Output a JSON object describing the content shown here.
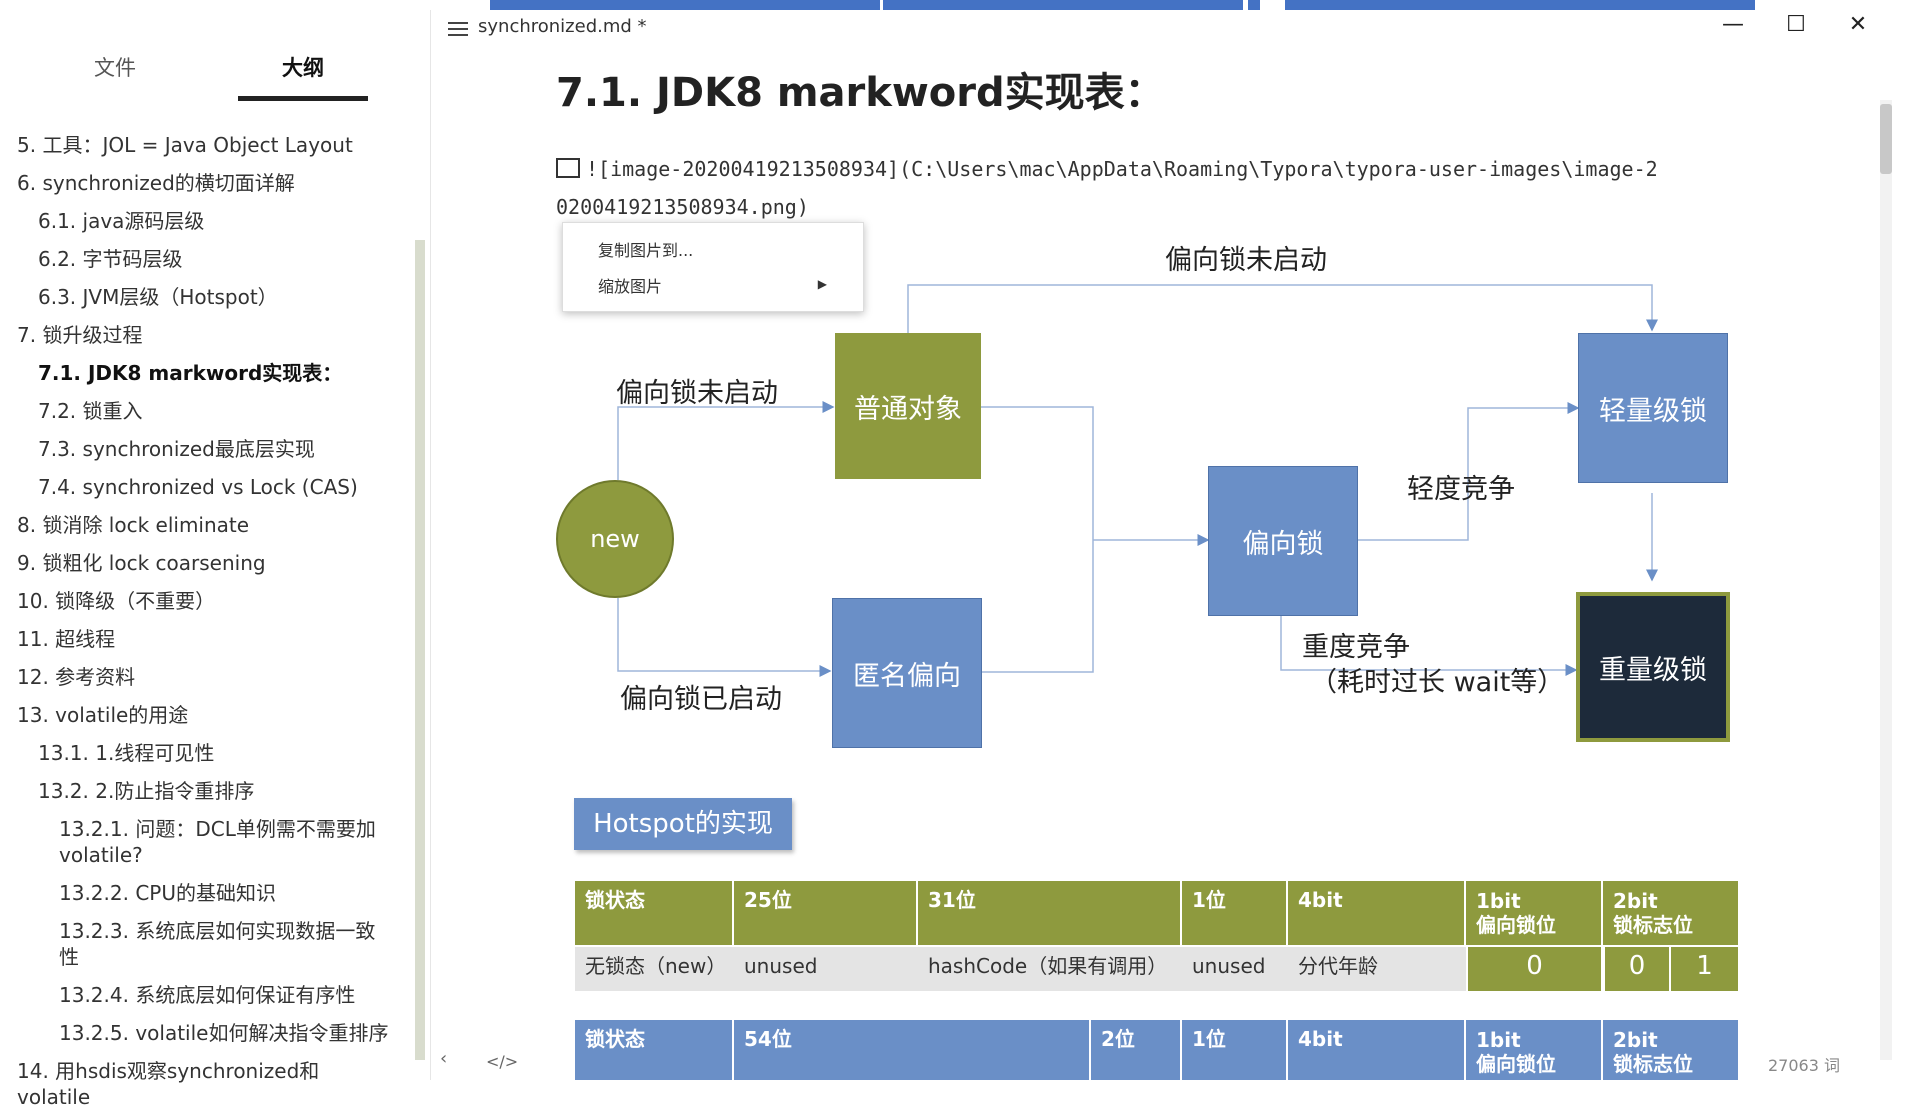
{
  "window": {
    "filename": "synchronized.md",
    "modified_mark": "*",
    "minimize": "—",
    "maximize": "☐",
    "close": "✕"
  },
  "sidebar": {
    "tabs": [
      {
        "label": "文件",
        "active": false
      },
      {
        "label": "大纲",
        "active": true
      }
    ],
    "outline": [
      {
        "label": "5. 工具：JOL = Java Object Layout",
        "level": 1
      },
      {
        "label": "6. synchronized的横切面详解",
        "level": 1
      },
      {
        "label": "6.1. java源码层级",
        "level": 2
      },
      {
        "label": "6.2. 字节码层级",
        "level": 2
      },
      {
        "label": "6.3. JVM层级（Hotspot）",
        "level": 2
      },
      {
        "label": "7. 锁升级过程",
        "level": 1
      },
      {
        "label": "7.1. JDK8 markword实现表：",
        "level": 2,
        "active": true
      },
      {
        "label": "7.2. 锁重入",
        "level": 2
      },
      {
        "label": "7.3. synchronized最底层实现",
        "level": 2
      },
      {
        "label": "7.4. synchronized vs Lock (CAS)",
        "level": 2
      },
      {
        "label": "8. 锁消除 lock eliminate",
        "level": 1
      },
      {
        "label": "9. 锁粗化 lock coarsening",
        "level": 1
      },
      {
        "label": "10. 锁降级（不重要）",
        "level": 1
      },
      {
        "label": "11. 超线程",
        "level": 1
      },
      {
        "label": "12. 参考资料",
        "level": 1
      },
      {
        "label": "13. volatile的用途",
        "level": 1
      },
      {
        "label": "13.1. 1.线程可见性",
        "level": 2
      },
      {
        "label": "13.2. 2.防止指令重排序",
        "level": 2
      },
      {
        "label": "13.2.1. 问题：DCL单例需不需要加volatile?",
        "level": 3
      },
      {
        "label": "13.2.2. CPU的基础知识",
        "level": 3
      },
      {
        "label": "13.2.3. 系统底层如何实现数据一致性",
        "level": 3
      },
      {
        "label": "13.2.4. 系统底层如何保证有序性",
        "level": 3
      },
      {
        "label": "13.2.5. volatile如何解决指令重排序",
        "level": 3
      },
      {
        "label": "14. 用hsdis观察synchronized和volatile",
        "level": 1
      }
    ],
    "bottom_icons": [
      "‹",
      "</>"
    ]
  },
  "doc": {
    "heading": "7.1. JDK8 markword实现表：",
    "image_md_line1": "![image-20200419213508934](C:\\Users\\mac\\AppData\\Roaming\\Typora\\typora-user-images\\image-2",
    "image_md_line2": "0200419213508934.png)",
    "context_menu": [
      "复制图片到...",
      "缩放图片"
    ],
    "diagram": {
      "nodes": {
        "new": "new",
        "normal": "普通对象",
        "anon_biased": "匿名偏向",
        "biased": "偏向锁",
        "light": "轻量级锁",
        "heavy": "重量级锁"
      },
      "labels": {
        "top": "偏向锁未启动",
        "upper_left": "偏向锁未启动",
        "lower_left": "偏向锁已启动",
        "light_contention": "轻度竞争",
        "heavy_contention": "重度竞争",
        "heavy_note": "（耗时过长 wait等）"
      }
    },
    "hotspot_button": "Hotspot的实现",
    "table1": {
      "headers": [
        "锁状态",
        "25位",
        "31位",
        "1位",
        "4bit",
        "1bit\n偏向锁位",
        "2bit\n锁标志位"
      ],
      "row": [
        "无锁态（new）",
        "unused",
        "hashCode（如果有调用）",
        "unused",
        "分代年龄",
        "0",
        "0",
        "1"
      ]
    },
    "table2": {
      "headers": [
        "锁状态",
        "54位",
        "2位",
        "1位",
        "4bit",
        "1bit\n偏向锁位",
        "2bit\n锁标志位"
      ]
    },
    "word_count": "27063 词"
  },
  "colors": {
    "green": "#8e9a3e",
    "blue": "#6a8fc7",
    "dark": "#1d2a3a",
    "accent_bar": "#4472c4"
  }
}
